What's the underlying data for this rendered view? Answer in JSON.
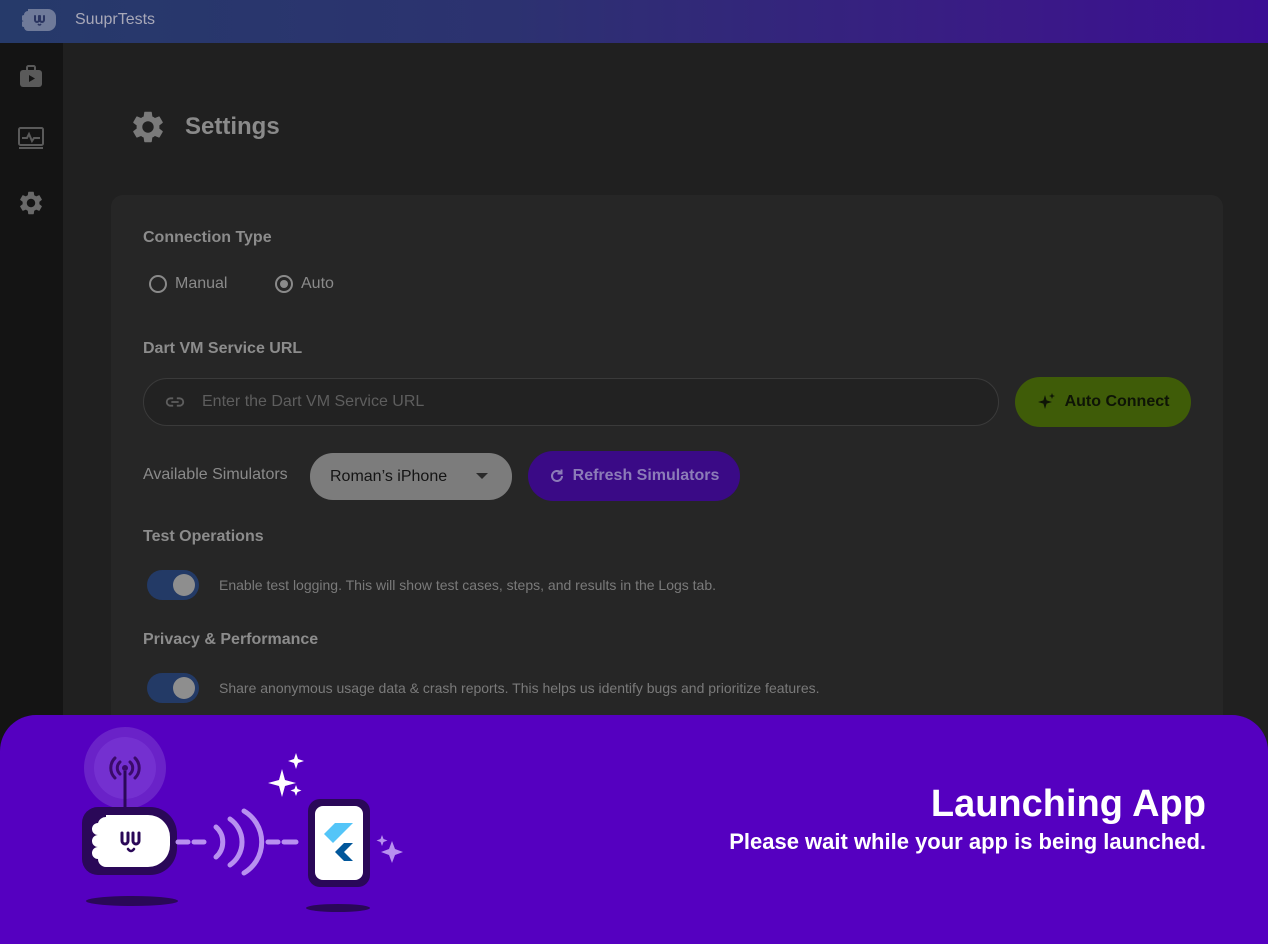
{
  "app": {
    "title": "SuuprTests"
  },
  "sidebar": {
    "items": [
      {
        "name": "tests",
        "icon": "briefcase-play-icon"
      },
      {
        "name": "logs",
        "icon": "monitor-pulse-icon"
      },
      {
        "name": "settings",
        "icon": "gear-icon"
      }
    ]
  },
  "page": {
    "title": "Settings",
    "icon": "gear-icon"
  },
  "connection": {
    "label": "Connection Type",
    "options": [
      "Manual",
      "Auto"
    ],
    "selected": "Auto"
  },
  "vm_url": {
    "label": "Dart VM Service URL",
    "placeholder": "Enter the Dart VM Service URL",
    "value": "",
    "auto_connect_label": "Auto Connect"
  },
  "simulators": {
    "label": "Available Simulators",
    "selected": "Roman’s iPhone",
    "refresh_label": "Refresh Simulators"
  },
  "test_operations": {
    "label": "Test Operations",
    "toggle_on": true,
    "text": "Enable test logging. This will show test cases, steps, and results in the Logs tab."
  },
  "privacy": {
    "label": "Privacy & Performance",
    "toggle_on": true,
    "text": "Share anonymous usage data & crash reports. This helps us identify bugs and prioritize features."
  },
  "launch": {
    "title": "Launching App",
    "subtitle": "Please wait while your app is being launched."
  },
  "colors": {
    "overlay": "#5500c0",
    "auto_connect_bg": "#3f5c08",
    "refresh_bg": "#3a0a86",
    "toggle_bg": "#233a66"
  }
}
